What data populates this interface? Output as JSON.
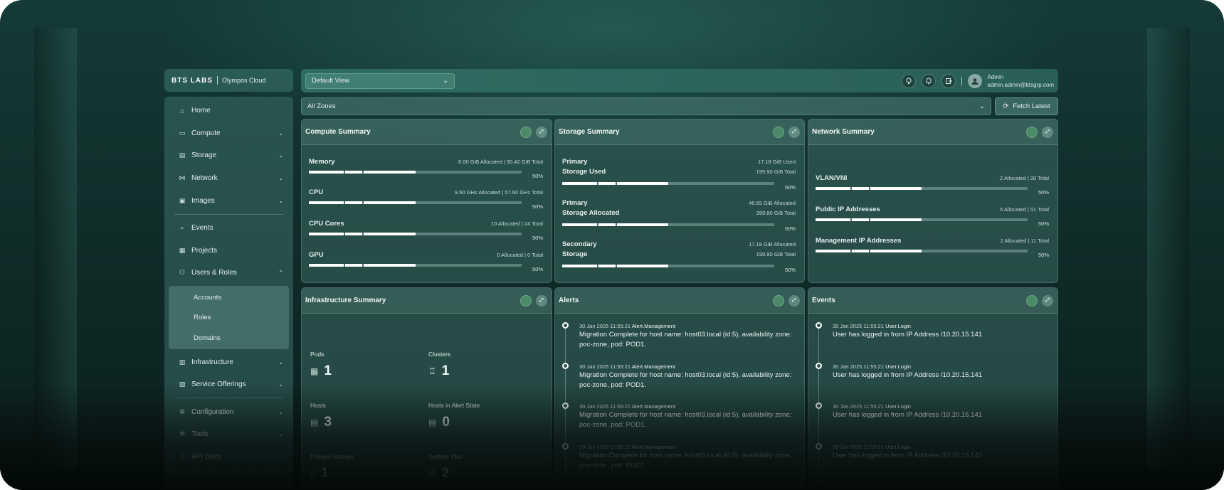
{
  "brand": {
    "logo": "BTS LABS",
    "product": "Olympos Cloud"
  },
  "header": {
    "view_select": "Default View",
    "icons": [
      "lightbulb-icon",
      "bell-icon",
      "export-icon"
    ],
    "user_name": "Admin",
    "user_email": "admin.admin@btsgrp.com"
  },
  "sidebar": {
    "items": [
      {
        "label": "Home",
        "icon": "home-icon",
        "chev": ""
      },
      {
        "label": "Compute",
        "icon": "compute-icon",
        "chev": "⌄"
      },
      {
        "label": "Storage",
        "icon": "storage-icon",
        "chev": "⌄"
      },
      {
        "label": "Network",
        "icon": "network-icon",
        "chev": "⌄"
      },
      {
        "label": "Images",
        "icon": "images-icon",
        "chev": "⌄"
      },
      {
        "label": "Events",
        "icon": "events-icon",
        "chev": ""
      },
      {
        "label": "Projects",
        "icon": "projects-icon",
        "chev": ""
      },
      {
        "label": "Users & Roles",
        "icon": "users-icon",
        "chev": "⌃"
      },
      {
        "label": "Infrastructure",
        "icon": "infrastructure-icon",
        "chev": "⌄"
      },
      {
        "label": "Service Offerings",
        "icon": "offerings-icon",
        "chev": "⌄"
      },
      {
        "label": "Configuration",
        "icon": "gear-icon",
        "chev": "⌄"
      },
      {
        "label": "Tools",
        "icon": "tools-icon",
        "chev": "⌄"
      },
      {
        "label": "API Docs",
        "icon": "docs-icon",
        "chev": ""
      }
    ],
    "sub_items": [
      "Accounts",
      "Roles",
      "Domains"
    ]
  },
  "zone_select": "All Zones",
  "fetch_label": "Fetch Latest",
  "compute": {
    "title": "Compute Summary",
    "metrics": [
      {
        "name": "Memory",
        "detail": "8.00 GiB Allocated | 90.42 GiB Total",
        "percent": 50
      },
      {
        "name": "CPU",
        "detail": "9.50 GHz Allocated | 57.60 GHz Total",
        "percent": 50
      },
      {
        "name": "CPU Cores",
        "detail": "10 Allocated | 24 Total",
        "percent": 50
      },
      {
        "name": "GPU",
        "detail": "0 Allocated | 0 Total",
        "percent": 50
      }
    ]
  },
  "storage": {
    "title": "Storage Summary",
    "metrics": [
      {
        "name1": "Primary",
        "name2": "Storage Used",
        "detail1": "17.18 GiB Used",
        "detail2": "199.90 GiB Total",
        "percent": 50
      },
      {
        "name1": "Primary",
        "name2": "Storage Allocated",
        "detail1": "46.65 GiB Allocated",
        "detail2": "399.80 GiB Total",
        "percent": 50
      },
      {
        "name1": "Secondary",
        "name2": "Storage",
        "detail1": "17.18 GiB Allocated",
        "detail2": "199.90 GiB Total",
        "percent": 50
      }
    ]
  },
  "network": {
    "title": "Network Summary",
    "metrics": [
      {
        "name": "VLAN/VNI",
        "detail": "2 Allocated | 20 Total",
        "percent": 50
      },
      {
        "name": "Public IP Addresses",
        "detail": "5 Allocated | 51 Total",
        "percent": 50
      },
      {
        "name": "Management IP Addresses",
        "detail": "2 Allocated | 11 Total",
        "percent": 50
      }
    ]
  },
  "infra": {
    "title": "Infrastructure Summary",
    "cells": [
      {
        "label": "Pods",
        "value": "1",
        "icon": "pods-icon"
      },
      {
        "label": "Clusters",
        "value": "1",
        "icon": "clusters-icon"
      },
      {
        "label": "Hosts",
        "value": "3",
        "icon": "hosts-icon"
      },
      {
        "label": "Hosts in Alert State",
        "value": "0",
        "icon": "alert-hosts-icon"
      },
      {
        "label": "Primary Storage",
        "value": "1",
        "icon": "primary-storage-icon"
      },
      {
        "label": "System VMs",
        "value": "2",
        "icon": "system-vms-icon"
      }
    ]
  },
  "alerts": {
    "title": "Alerts",
    "items": [
      {
        "time": "30 Jan 2025 11:55:21",
        "type": "Alert.Management",
        "text": "Migration Complete for host name: host03.local (id:5), availability zone: poc-zone, pod: POD1."
      },
      {
        "time": "30 Jan 2025 11:55:21",
        "type": "Alert.Management",
        "text": "Migration Complete for host name: host03.local (id:5), availability zone: poc-zone, pod: POD1."
      },
      {
        "time": "30 Jan 2025 11:55:21",
        "type": "Alert.Management",
        "text": "Migration Complete for host name: host03.local (id:5), availability zone: poc-zone, pod: POD1."
      },
      {
        "time": "30 Jan 2025 11:55:21",
        "type": "Alert.Management",
        "text": "Migration Complete for host name: host03.local (id:5), availability zone: poc-zone, pod: POD1."
      }
    ]
  },
  "events": {
    "title": "Events",
    "items": [
      {
        "time": "30 Jan 2025 11:55:21",
        "type": "User.Login",
        "text": "User has logged in from IP Address /10.20.15.141"
      },
      {
        "time": "30 Jan 2025 11:55:21",
        "type": "User.Login",
        "text": "User has logged in from IP Address /10.20.15.141"
      },
      {
        "time": "30 Jan 2025 11:55:21",
        "type": "User.Login",
        "text": "User has logged in from IP Address /10.20.15.141"
      },
      {
        "time": "30 Jan 2025 11:55:21",
        "type": "User.Login",
        "text": "User has logged in from IP Address /10.20.15.141"
      }
    ]
  }
}
